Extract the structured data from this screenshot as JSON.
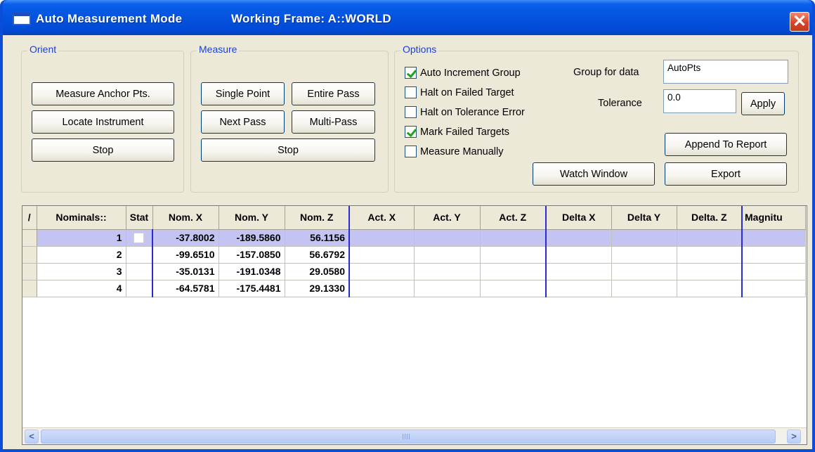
{
  "window": {
    "title": "Auto Measurement Mode",
    "working_frame": "Working Frame:  A::WORLD",
    "close_glyph": "✕"
  },
  "orient": {
    "legend": "Orient",
    "measure_anchor_label": "Measure Anchor Pts.",
    "locate_instrument_label": "Locate Instrument",
    "stop_label": "Stop"
  },
  "measure": {
    "legend": "Measure",
    "single_point_label": "Single Point",
    "entire_pass_label": "Entire Pass",
    "next_pass_label": "Next Pass",
    "multi_pass_label": "Multi-Pass",
    "stop_label": "Stop"
  },
  "options": {
    "legend": "Options",
    "checkboxes": [
      {
        "label": "Auto Increment Group",
        "checked": true
      },
      {
        "label": "Halt on Failed Target",
        "checked": false
      },
      {
        "label": "Halt on Tolerance Error",
        "checked": false
      },
      {
        "label": "Mark Failed Targets",
        "checked": true
      },
      {
        "label": "Measure Manually",
        "checked": false
      }
    ],
    "group_for_data_label": "Group for data",
    "group_for_data_value": "AutoPts",
    "tolerance_label": "Tolerance",
    "tolerance_value": "0.0",
    "apply_label": "Apply",
    "append_report_label": "Append To Report",
    "watch_window_label": "Watch Window",
    "export_label": "Export"
  },
  "grid": {
    "columns": [
      "/",
      "Nominals::",
      "Stat",
      "Nom. X",
      "Nom. Y",
      "Nom. Z",
      "Act. X",
      "Act. Y",
      "Act. Z",
      "Delta X",
      "Delta Y",
      "Delta. Z",
      "Magnitu"
    ],
    "rows": [
      {
        "name": "1",
        "nom_x": "-37.8002",
        "nom_y": "-189.5860",
        "nom_z": "56.1156",
        "selected": true
      },
      {
        "name": "2",
        "nom_x": "-99.6510",
        "nom_y": "-157.0850",
        "nom_z": "56.6792",
        "selected": false
      },
      {
        "name": "3",
        "nom_x": "-35.0131",
        "nom_y": "-191.0348",
        "nom_z": "29.0580",
        "selected": false
      },
      {
        "name": "4",
        "nom_x": "-64.5781",
        "nom_y": "-175.4481",
        "nom_z": "29.1330",
        "selected": false
      }
    ],
    "scroll_left_glyph": "<",
    "scroll_right_glyph": ">"
  },
  "colors": {
    "titlebar": "#0453df",
    "dialog_bg": "#ece9d8",
    "selected_row": "#c3c4f2",
    "group_legend": "#1c3fd2",
    "column_divider": "#2b2bd2"
  }
}
